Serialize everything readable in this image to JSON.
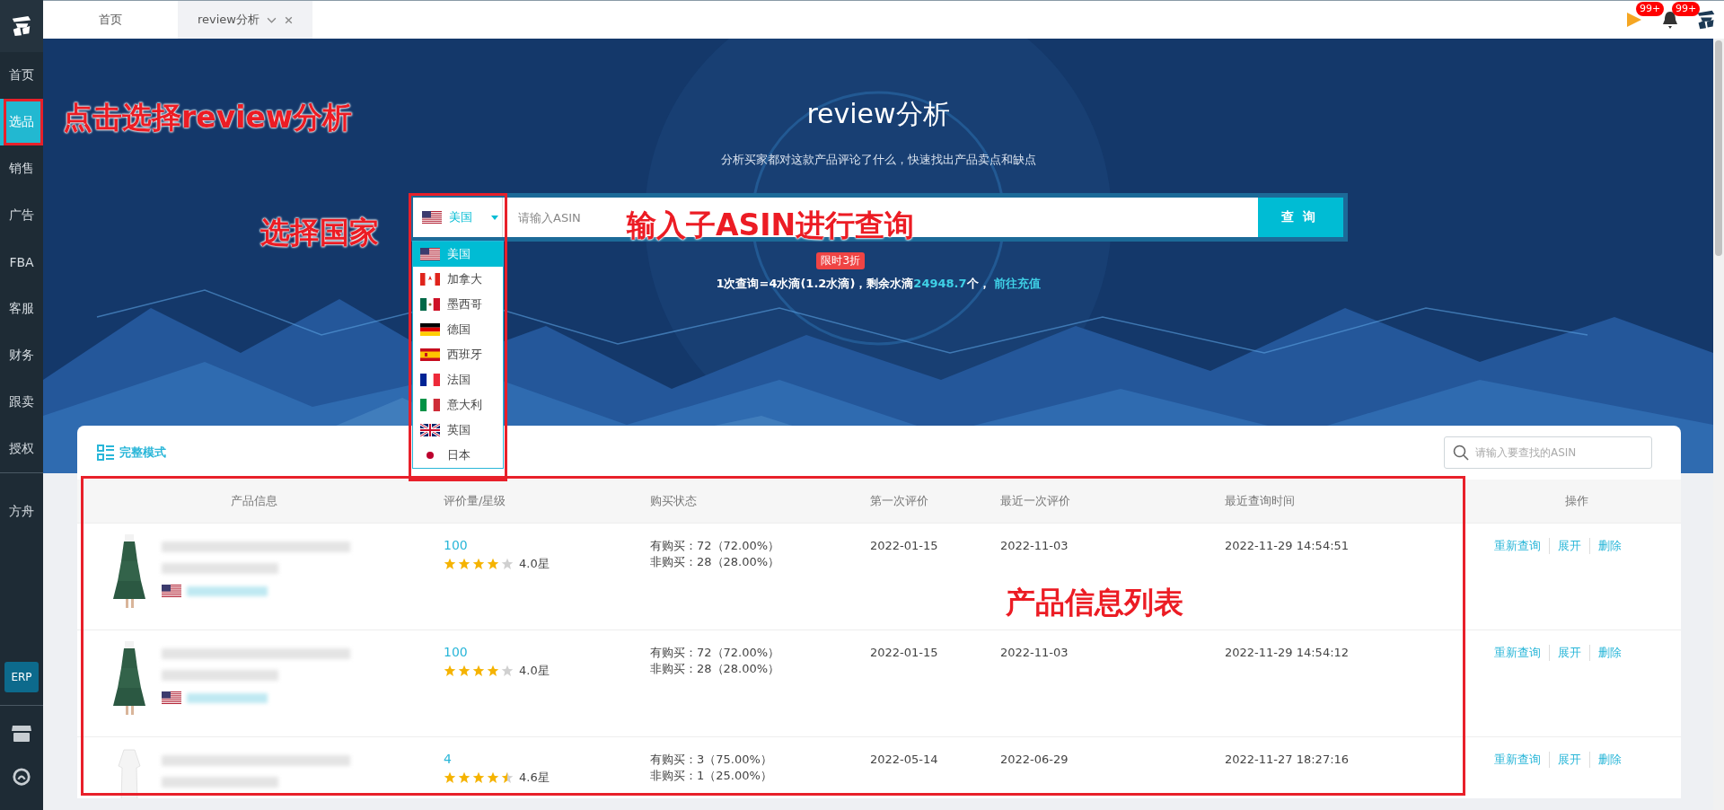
{
  "tabs": [
    {
      "label": "首页",
      "selected": false,
      "closable": false
    },
    {
      "label": "review分析",
      "selected": true,
      "closable": true
    }
  ],
  "header_icons": [
    {
      "kind": "flag",
      "badge": "99+"
    },
    {
      "kind": "bell",
      "badge": "99+"
    },
    {
      "kind": "avatar"
    }
  ],
  "sidebar": {
    "groups": [
      [
        {
          "label": "首页",
          "selected": false
        },
        {
          "label": "选品",
          "selected": true
        },
        {
          "label": "销售",
          "selected": false
        },
        {
          "label": "广告",
          "selected": false
        },
        {
          "label": "FBA",
          "selected": false
        },
        {
          "label": "客服",
          "selected": false
        },
        {
          "label": "财务",
          "selected": false
        },
        {
          "label": "跟卖",
          "selected": false
        },
        {
          "label": "授权",
          "selected": false
        }
      ],
      [
        {
          "label": "方舟",
          "selected": false
        }
      ]
    ],
    "erp": "ERP"
  },
  "banner": {
    "title": "review分析",
    "subtitle": "分析买家都对这款产品评论了什么，快速找出产品卖点和缺点",
    "country": {
      "kind": "us",
      "label": "美国"
    },
    "options": [
      {
        "kind": "us",
        "label": "美国",
        "selected": true
      },
      {
        "kind": "ca",
        "label": "加拿大",
        "selected": false
      },
      {
        "kind": "mx",
        "label": "墨西哥",
        "selected": false
      },
      {
        "kind": "de",
        "label": "德国",
        "selected": false
      },
      {
        "kind": "es",
        "label": "西班牙",
        "selected": false
      },
      {
        "kind": "fr",
        "label": "法国",
        "selected": false
      },
      {
        "kind": "it",
        "label": "意大利",
        "selected": false
      },
      {
        "kind": "gb",
        "label": "英国",
        "selected": false
      },
      {
        "kind": "jp",
        "label": "日本",
        "selected": false
      }
    ],
    "placeholder": "请输入ASIN",
    "button": "查询",
    "promo_badge": "限时3折",
    "quota": {
      "before": "1次查询=4水滴(1.2水滴)，剩余水滴",
      "amount": "24948.7",
      "after": "个，",
      "link": "前往充值"
    }
  },
  "list": {
    "mode_button": "完整模式",
    "search_placeholder": "请输入要查找的ASIN",
    "columns": [
      "产品信息",
      "评价量/星级",
      "购买状态",
      "第一次评价",
      "最近一次评价",
      "最近查询时间",
      "操作"
    ],
    "rows": [
      {
        "image": {
          "kind": "picture"
        },
        "flag": {
          "kind": "us"
        },
        "reviews": "100",
        "stars": 4,
        "rating": "4.0星",
        "purchased": "有购买：72（72.00%）",
        "not_purchased": "非购买：28（28.00%）",
        "first_review": "2022-01-15",
        "last_review": "2022-11-03",
        "queried": "2022-11-29 14:54:51",
        "actions": [
          "重新查询",
          "展开",
          "删除"
        ]
      },
      {
        "image": {
          "kind": "picture"
        },
        "flag": {
          "kind": "us"
        },
        "reviews": "100",
        "stars": 4,
        "rating": "4.0星",
        "purchased": "有购买：72（72.00%）",
        "not_purchased": "非购买：28（28.00%）",
        "first_review": "2022-01-15",
        "last_review": "2022-11-03",
        "queried": "2022-11-29 14:54:12",
        "actions": [
          "重新查询",
          "展开",
          "删除"
        ]
      },
      {
        "image": {
          "kind": "picture"
        },
        "reviews": "4",
        "stars": 4.5,
        "rating": "4.6星",
        "purchased": "有购买：3（75.00%）",
        "not_purchased": "非购买：1（25.00%）",
        "first_review": "2022-05-14",
        "last_review": "2022-06-29",
        "queried": "2022-11-27 18:27:16",
        "actions": [
          "重新查询",
          "展开",
          "删除"
        ]
      }
    ]
  },
  "annotations": [
    {
      "kind": "sidebar-note",
      "text": "点击选择review分析"
    },
    {
      "kind": "country-note",
      "text": "选择国家"
    },
    {
      "kind": "search-note",
      "text": "输入子ASIN进行查询"
    },
    {
      "kind": "table-note",
      "text": "产品信息列表"
    }
  ]
}
